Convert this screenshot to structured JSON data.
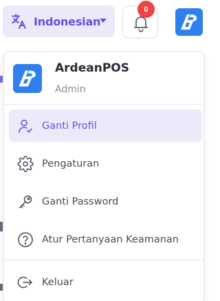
{
  "topbar": {
    "language_label": "Indonesian",
    "notification_count": "0"
  },
  "profile_menu": {
    "app_name": "ArdeanPOS",
    "user_role": "Admin",
    "items": [
      {
        "label": "Ganti Profil",
        "icon": "user-edit-icon",
        "active": true
      },
      {
        "label": "Pengaturan",
        "icon": "gear-icon",
        "active": false
      },
      {
        "label": "Ganti Password",
        "icon": "key-icon",
        "active": false
      },
      {
        "label": "Atur Pertanyaan Keamanan",
        "icon": "question-circle-icon",
        "active": false
      },
      {
        "label": "Keluar",
        "icon": "logout-icon",
        "active": false
      }
    ]
  },
  "colors": {
    "accent": "#6b4fe0",
    "accent_bg": "#ece9fb",
    "badge": "#ef4444",
    "logo_blue": "#2f80ed"
  }
}
